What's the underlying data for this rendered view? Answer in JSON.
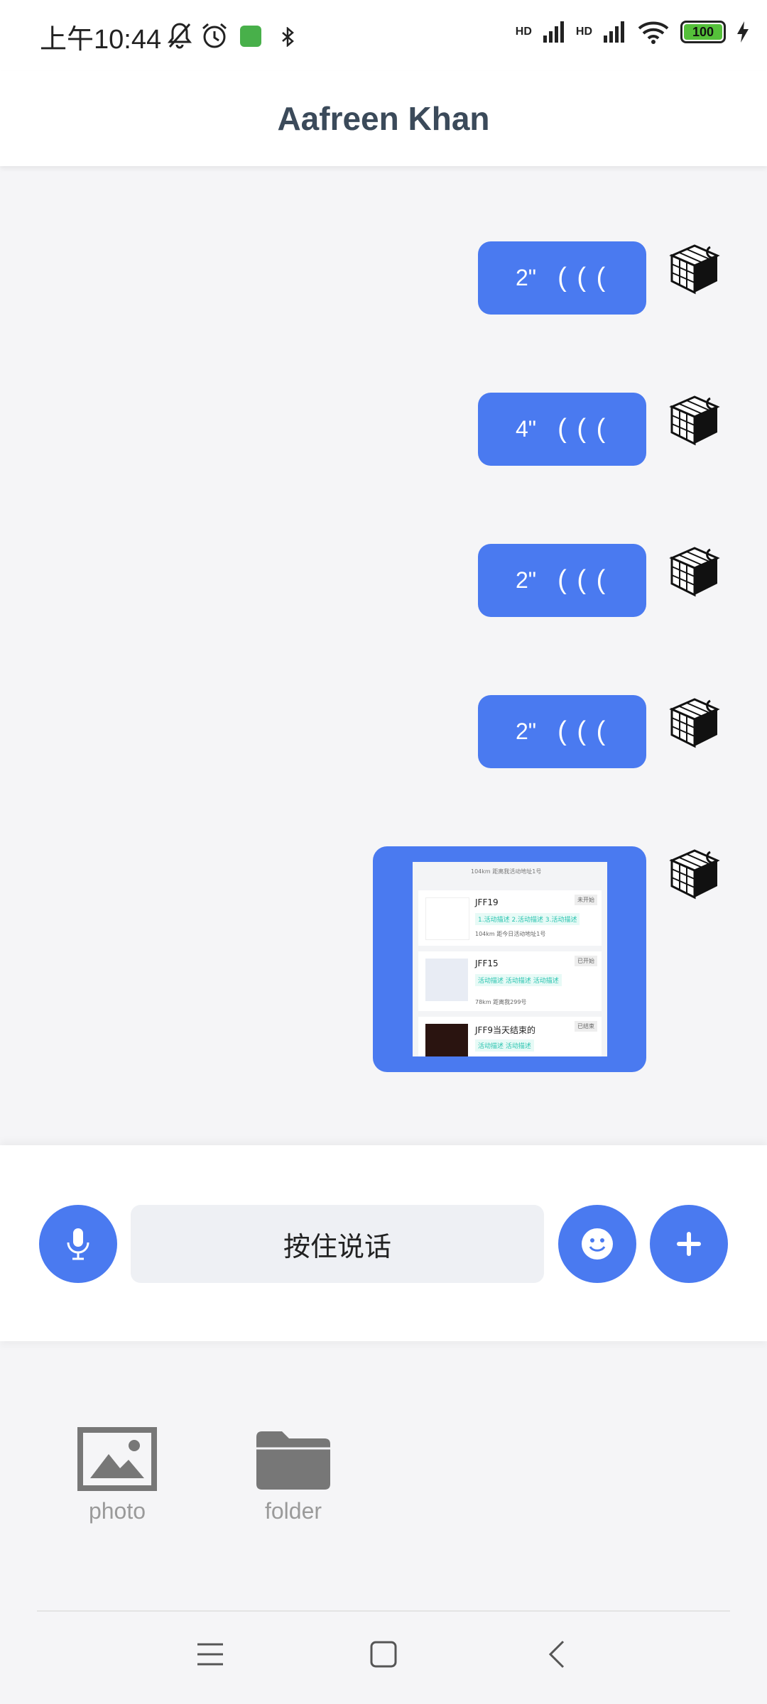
{
  "status_bar": {
    "time": "上午10:44",
    "network_1": "HD",
    "network_2": "HD",
    "battery": "100",
    "icons": [
      "bell-off-icon",
      "alarm-icon",
      "app-badge-icon",
      "bluetooth-icon",
      "signal-icon",
      "signal-icon",
      "wifi-icon",
      "battery-icon",
      "charging-icon"
    ]
  },
  "header": {
    "title": "Aafreen Khan"
  },
  "messages": [
    {
      "type": "voice",
      "duration": "2\"",
      "waves": "( ( ("
    },
    {
      "type": "voice",
      "duration": "4\"",
      "waves": "( ( ("
    },
    {
      "type": "voice",
      "duration": "2\"",
      "waves": "( ( ("
    },
    {
      "type": "voice",
      "duration": "2\"",
      "waves": "( ( ("
    },
    {
      "type": "image",
      "preview": {
        "top_note": "104km 距离我活动地址1号",
        "cards": [
          {
            "title": "JFF19",
            "tags": "1.活动描述 2.活动描述 3.活动描述",
            "note": "104km 距今日活动地址1号",
            "badge": "未开始"
          },
          {
            "title": "JFF15",
            "tags": "活动描述  活动描述  活动描述",
            "note": "78km 距离我299号",
            "badge": "已开始"
          },
          {
            "title": "JFF9当天结束的",
            "tags": "活动描述  活动描述",
            "note": "",
            "badge": "已结束"
          }
        ]
      }
    }
  ],
  "input_bar": {
    "hold_to_talk": "按住说话",
    "mic_icon": "microphone-icon",
    "emoji_icon": "emoji-icon",
    "plus_icon": "plus-icon"
  },
  "attach_panel": {
    "items": [
      {
        "label": "photo",
        "icon": "photo-icon"
      },
      {
        "label": "folder",
        "icon": "folder-icon"
      }
    ]
  },
  "colors": {
    "accent": "#4a7af0",
    "title": "#3b4a5a",
    "muted": "#9a9a9a"
  }
}
